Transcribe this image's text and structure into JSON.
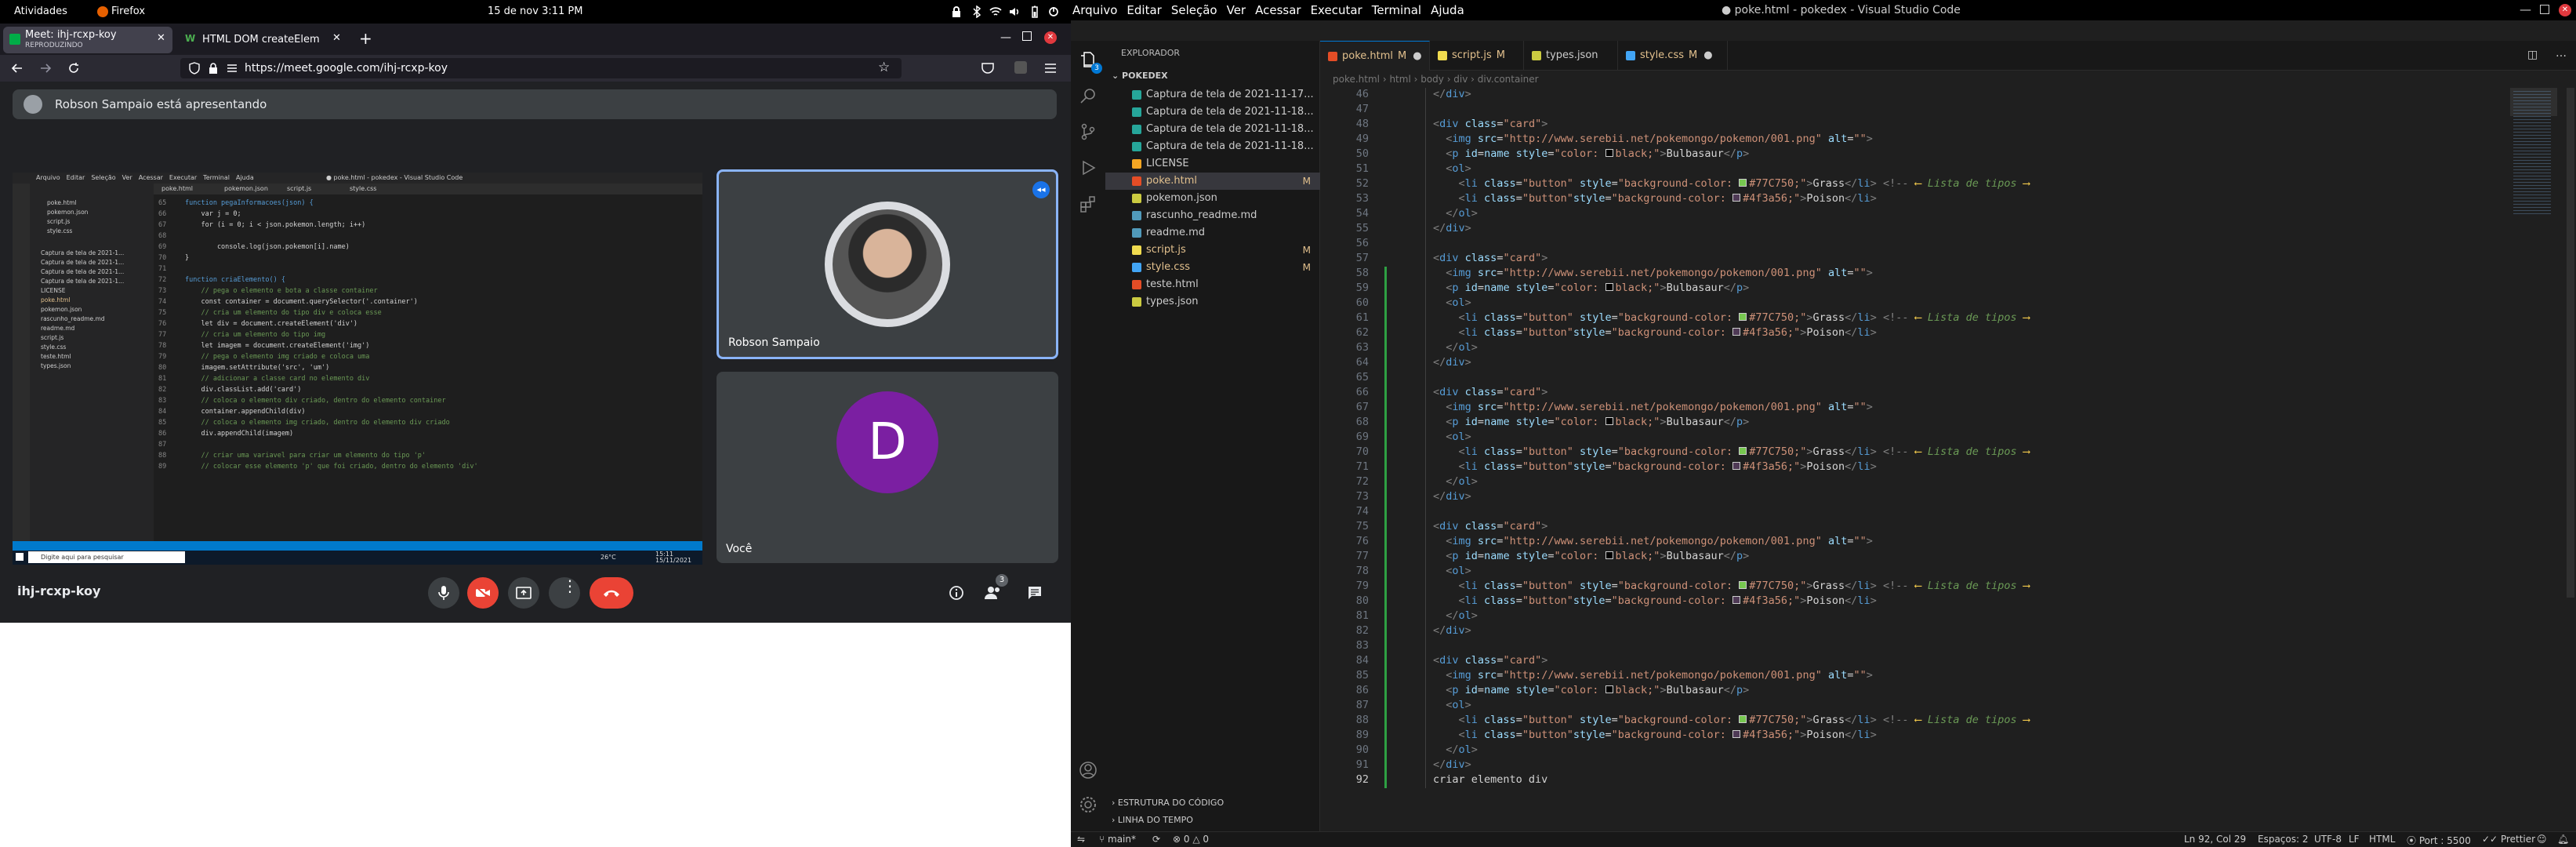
{
  "gnome": {
    "activities": "Atividades",
    "app": "Firefox",
    "clock": "15 de nov  3:11 PM"
  },
  "firefox": {
    "tabs": [
      {
        "title": "Meet: ihj-rcxp-koy",
        "subtitle": "REPRODUZINDO",
        "active": true
      },
      {
        "title": "HTML DOM createEleme",
        "subtitle": "",
        "active": false
      }
    ],
    "url": "https://meet.google.com/ihj-rcxp-koy"
  },
  "meet": {
    "presenting_banner": "Robson Sampaio está apresentando",
    "participants": [
      {
        "name": "Robson Sampaio",
        "initial": ""
      },
      {
        "name": "Você",
        "initial": "D"
      }
    ],
    "meeting_code": "ihj-rcxp-koy",
    "participant_count": "3",
    "colors": {
      "bg": "#202124",
      "end_call": "#ea4335",
      "avatar_you": "#7b1fa2",
      "active_border": "#8ab4f8"
    }
  },
  "shared_screen": {
    "menu": [
      "Arquivo",
      "Editar",
      "Seleção",
      "Ver",
      "Acessar",
      "Executar",
      "Terminal",
      "Ajuda"
    ],
    "title": "● poke.html - pokedex - Visual Studio Code",
    "tabs": [
      "poke.html",
      "pokemon.json",
      "script.js",
      "style.css"
    ],
    "files": [
      "poke.html",
      "pokemon.json",
      "script.js",
      "style.css",
      "Captura de tela de 2021-1...",
      "Captura de tela de 2021-1...",
      "Captura de tela de 2021-1...",
      "Captura de tela de 2021-1...",
      "LICENSE",
      "poke.html",
      "pokemon.json",
      "rascunho_readme.md",
      "readme.md",
      "script.js",
      "style.css",
      "teste.html",
      "types.json"
    ],
    "code": [
      {
        "n": "65",
        "t": "function pegaInformacoes(json) {"
      },
      {
        "n": "66",
        "t": "    var j = 0;"
      },
      {
        "n": "67",
        "t": "    for (i = 0; i < json.pokemon.length; i++)"
      },
      {
        "n": "68",
        "t": ""
      },
      {
        "n": "69",
        "t": "        console.log(json.pokemon[i].name)"
      },
      {
        "n": "70",
        "t": "}"
      },
      {
        "n": "71",
        "t": ""
      },
      {
        "n": "72",
        "t": "function criaElemento() {"
      },
      {
        "n": "73",
        "t": "    // pega o elemento e bota a classe container"
      },
      {
        "n": "74",
        "t": "    const container = document.querySelector('.container')"
      },
      {
        "n": "75",
        "t": "    // cria um elemento do tipo div e coloca esse"
      },
      {
        "n": "76",
        "t": "    let div = document.createElement('div')"
      },
      {
        "n": "77",
        "t": "    // cria um elemento do tipo img"
      },
      {
        "n": "78",
        "t": "    let imagem = document.createElement('img')"
      },
      {
        "n": "79",
        "t": "    // pega o elemento img criado e coloca uma"
      },
      {
        "n": "80",
        "t": "    imagem.setAttribute('src', 'um')"
      },
      {
        "n": "81",
        "t": "    // adicionar a classe card no elemento div"
      },
      {
        "n": "82",
        "t": "    div.classList.add('card')"
      },
      {
        "n": "83",
        "t": "    // coloca o elemento div criado, dentro do elemento container"
      },
      {
        "n": "84",
        "t": "    container.appendChild(div)"
      },
      {
        "n": "85",
        "t": "    // coloca o elemento img criado, dentro do elemento div criado"
      },
      {
        "n": "86",
        "t": "    div.appendChild(imagem)"
      },
      {
        "n": "87",
        "t": ""
      },
      {
        "n": "88",
        "t": "    // criar uma variavel para criar um elemento do tipo 'p'"
      },
      {
        "n": "89",
        "t": "    // colocar esse elemento 'p' que foi criado, dentro do elemento 'div'"
      }
    ],
    "taskbar_search": "Digite aqui para pesquisar",
    "taskbar_temp": "26°C",
    "taskbar_time": "15:11",
    "taskbar_date": "15/11/2021"
  },
  "vscode": {
    "menu": [
      "Arquivo",
      "Editar",
      "Seleção",
      "Ver",
      "Acessar",
      "Executar",
      "Terminal",
      "Ajuda"
    ],
    "title": "● poke.html - pokedex - Visual Studio Code",
    "explorer_title": "EXPLORADOR",
    "project": "POKEDEX",
    "files": [
      {
        "name": "Captura de tela de 2021-11-17...",
        "status": "",
        "icon": "image"
      },
      {
        "name": "Captura de tela de 2021-11-18...",
        "status": "",
        "icon": "image"
      },
      {
        "name": "Captura de tela de 2021-11-18...",
        "status": "",
        "icon": "image"
      },
      {
        "name": "Captura de tela de 2021-11-18...",
        "status": "",
        "icon": "image"
      },
      {
        "name": "LICENSE",
        "status": "",
        "icon": "license"
      },
      {
        "name": "poke.html",
        "status": "M",
        "icon": "html",
        "selected": true
      },
      {
        "name": "pokemon.json",
        "status": "",
        "icon": "json"
      },
      {
        "name": "rascunho_readme.md",
        "status": "",
        "icon": "md"
      },
      {
        "name": "readme.md",
        "status": "",
        "icon": "md"
      },
      {
        "name": "script.js",
        "status": "M",
        "icon": "js"
      },
      {
        "name": "style.css",
        "status": "M",
        "icon": "css"
      },
      {
        "name": "teste.html",
        "status": "",
        "icon": "html"
      },
      {
        "name": "types.json",
        "status": "",
        "icon": "json"
      }
    ],
    "outline": "ESTRUTURA DO CÓDIGO",
    "timeline": "LINHA DO TEMPO",
    "tabs": [
      {
        "label": "poke.html",
        "badge": "M",
        "dirty": true,
        "active": true,
        "icon": "html"
      },
      {
        "label": "script.js",
        "badge": "M",
        "dirty": false,
        "active": false,
        "icon": "js"
      },
      {
        "label": "types.json",
        "badge": "",
        "dirty": false,
        "active": false,
        "icon": "json"
      },
      {
        "label": "style.css",
        "badge": "M",
        "dirty": true,
        "active": false,
        "icon": "css"
      }
    ],
    "breadcrumbs": "poke.html  ›  html  ›  body  ›  div  ›  div.container",
    "card": {
      "img_src": "http://www.serebii.net/pokemongo/pokemon/001.png",
      "name": "Bulbasaur",
      "type1": "Grass",
      "type1_color": "#77C750",
      "type2": "Poison",
      "type2_color": "#4f3a56",
      "comment": "Lista de tipos"
    },
    "line_numbers": [
      "46",
      "47",
      "48",
      "49",
      "50",
      "51",
      "52",
      "53",
      "54",
      "55",
      "56",
      "57",
      "58",
      "59",
      "60",
      "61",
      "62",
      "63",
      "64",
      "65",
      "66",
      "67",
      "68",
      "69",
      "70",
      "71",
      "72",
      "73",
      "74",
      "75",
      "76",
      "77",
      "78",
      "79",
      "80",
      "81",
      "82",
      "83",
      "84",
      "85",
      "86",
      "87",
      "88",
      "89",
      "90",
      "91",
      "92"
    ],
    "last_line": "criar elemento div",
    "status": {
      "branch": "main*",
      "errors": "0",
      "warnings": "0",
      "position": "Ln 92, Col 29",
      "spaces": "Espaços: 2",
      "encoding": "UTF-8",
      "eol": "LF",
      "language": "HTML",
      "port": "Port : 5500",
      "prettier": "Prettier"
    }
  }
}
